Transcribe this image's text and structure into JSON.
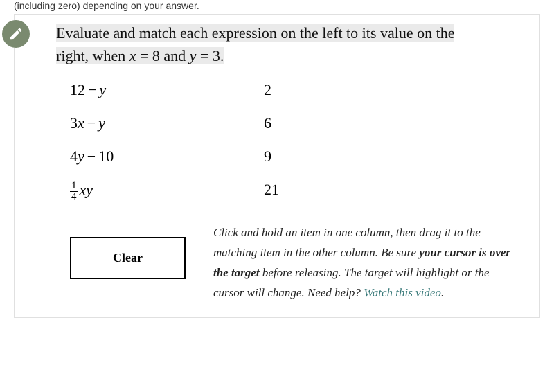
{
  "top_fragment": "(including zero) depending on your answer.",
  "prompt": {
    "part1": "Evaluate and match each expression on the left to its value on the",
    "part2a": "right, when ",
    "var1": "x",
    "eq1": " = ",
    "val1": "8",
    "and": " and ",
    "var2": "y",
    "eq2": " = ",
    "val2": "3",
    "end": "."
  },
  "expressions": [
    {
      "type": "sub",
      "a_num": "12",
      "b_var": "y"
    },
    {
      "type": "coef_sub",
      "coef": "3",
      "a_var": "x",
      "b_var": "y"
    },
    {
      "type": "coef_sub_num",
      "coef": "4",
      "a_var": "y",
      "b_num": "10"
    },
    {
      "type": "frac_prod",
      "frac_top": "1",
      "frac_bot": "4",
      "a_var": "x",
      "b_var": "y"
    }
  ],
  "values": [
    "2",
    "6",
    "9",
    "21"
  ],
  "clear_label": "Clear",
  "instructions": {
    "t1": "Click and hold an item in one column, then drag it to the matching item in the other column. Be sure ",
    "b1": "your cursor is over the target",
    "t2": " before releasing. The target will highlight or the cursor will change. Need help? ",
    "link": "Watch this video",
    "t3": "."
  }
}
